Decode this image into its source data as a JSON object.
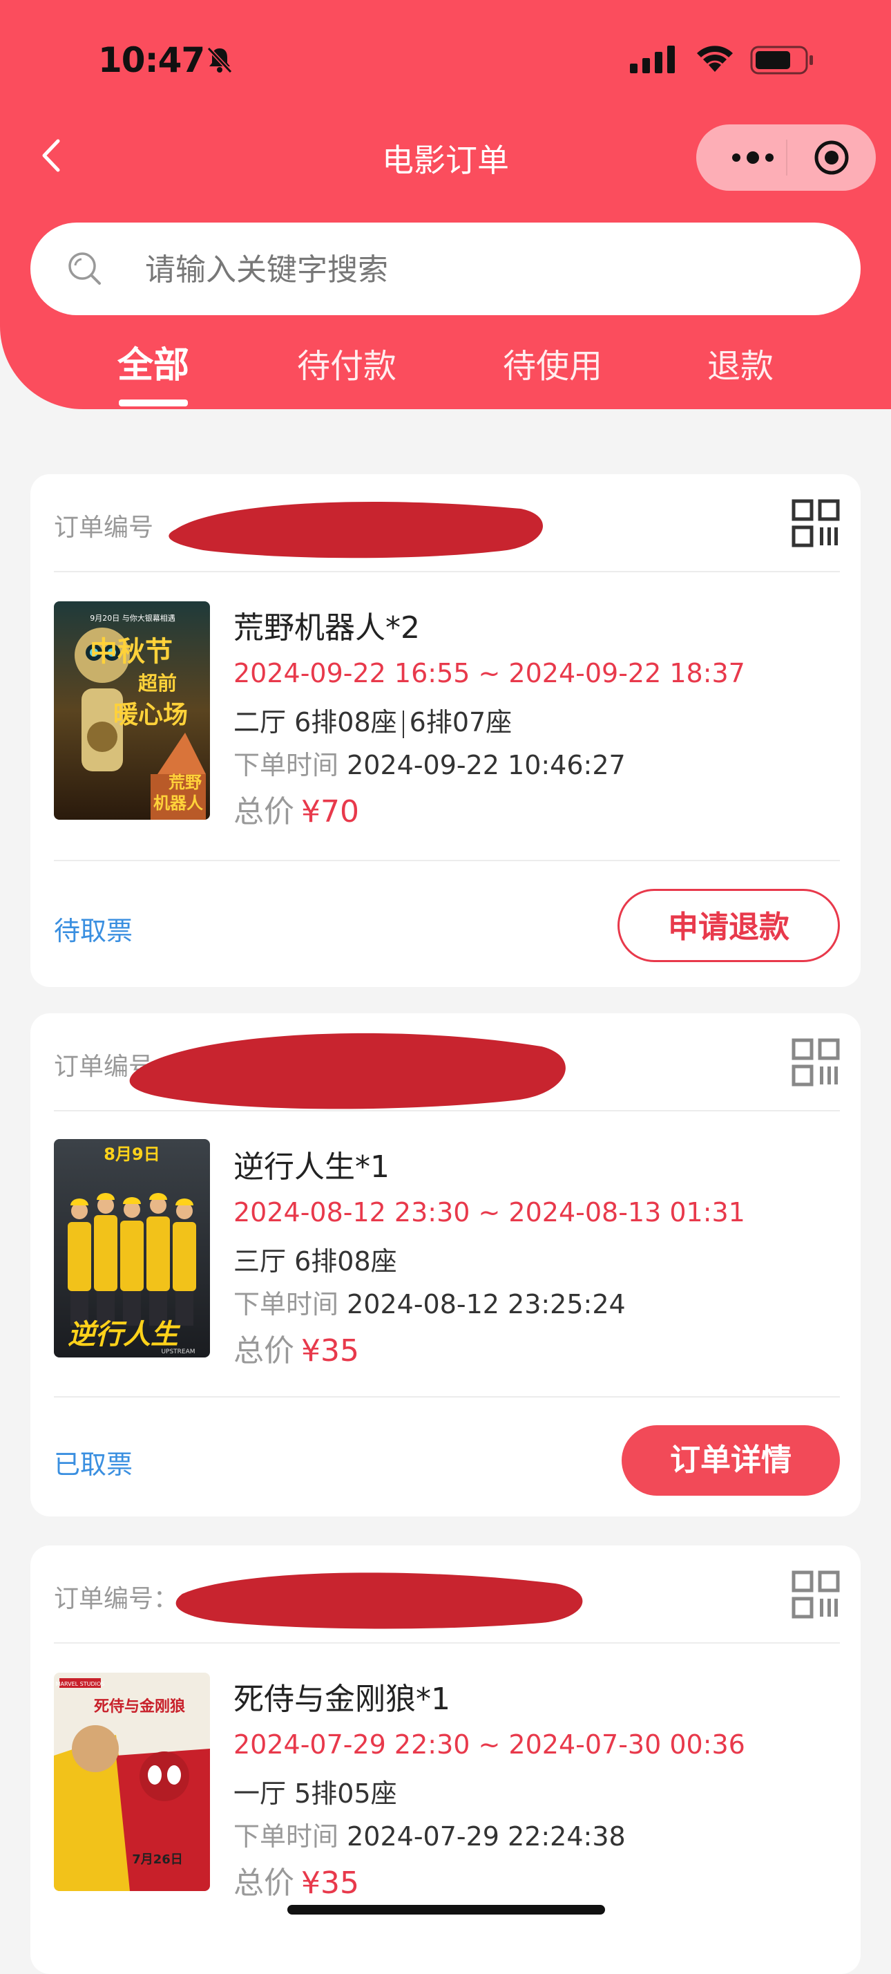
{
  "status_bar": {
    "time": "10:47",
    "icons": [
      "bell-slash-icon",
      "signal-icon",
      "wifi-icon",
      "battery-icon"
    ]
  },
  "header": {
    "title": "电影订单",
    "back_icon": "chevron-left-icon",
    "capsule_icons": [
      "more-dots-icon",
      "target-icon"
    ],
    "background": "#fb4d5d"
  },
  "search": {
    "placeholder": "请输入关键字搜索",
    "value": "",
    "icon": "search-icon"
  },
  "tabs": [
    {
      "label": "全部",
      "active": true
    },
    {
      "label": "待付款",
      "active": false
    },
    {
      "label": "待使用",
      "active": false
    },
    {
      "label": "退款",
      "active": false
    }
  ],
  "orders": [
    {
      "order_no_label": "订单编号",
      "movie": "荒野机器人*2",
      "time_range": "2024-09-22 16:55 ~ 2024-09-22 18:37",
      "hall": "二厅",
      "seat_1": "6排08座",
      "seat_2": "6排07座",
      "order_time_label": "下单时间",
      "order_time": "2024-09-22 10:46:27",
      "price_label": "总价",
      "price": "¥70",
      "status": "待取票",
      "action": "申请退款",
      "poster_text": [
        "9月20日 与你大银幕相遇",
        "中秋节",
        "超前",
        "暖心场",
        "荒野",
        "机器人"
      ]
    },
    {
      "order_no_label": "订单编号",
      "movie": "逆行人生*1",
      "time_range": "2024-08-12 23:30 ~ 2024-08-13 01:31",
      "hall": "三厅",
      "seat_1": "6排08座",
      "order_time_label": "下单时间",
      "order_time": "2024-08-12 23:25:24",
      "price_label": "总价",
      "price": "¥35",
      "status": "已取票",
      "action": "订单详情",
      "poster_text": [
        "8月9日",
        "逆行人生",
        "UPSTREAM"
      ]
    },
    {
      "order_no_label": "订单编号：",
      "movie": "死侍与金刚狼*1",
      "time_range": "2024-07-29 22:30 ~ 2024-07-30 00:36",
      "hall": "一厅",
      "seat_1": "5排05座",
      "order_time_label": "下单时间",
      "order_time": "2024-07-29 22:24:38",
      "price_label": "总价",
      "price": "¥35",
      "poster_text": [
        "MARVEL STUDIOS",
        "死侍与金刚狼",
        "7月26日"
      ]
    }
  ],
  "colors": {
    "accent": "#e8394b",
    "status_blue": "#3a8fe0",
    "redaction": "#c8242f"
  }
}
